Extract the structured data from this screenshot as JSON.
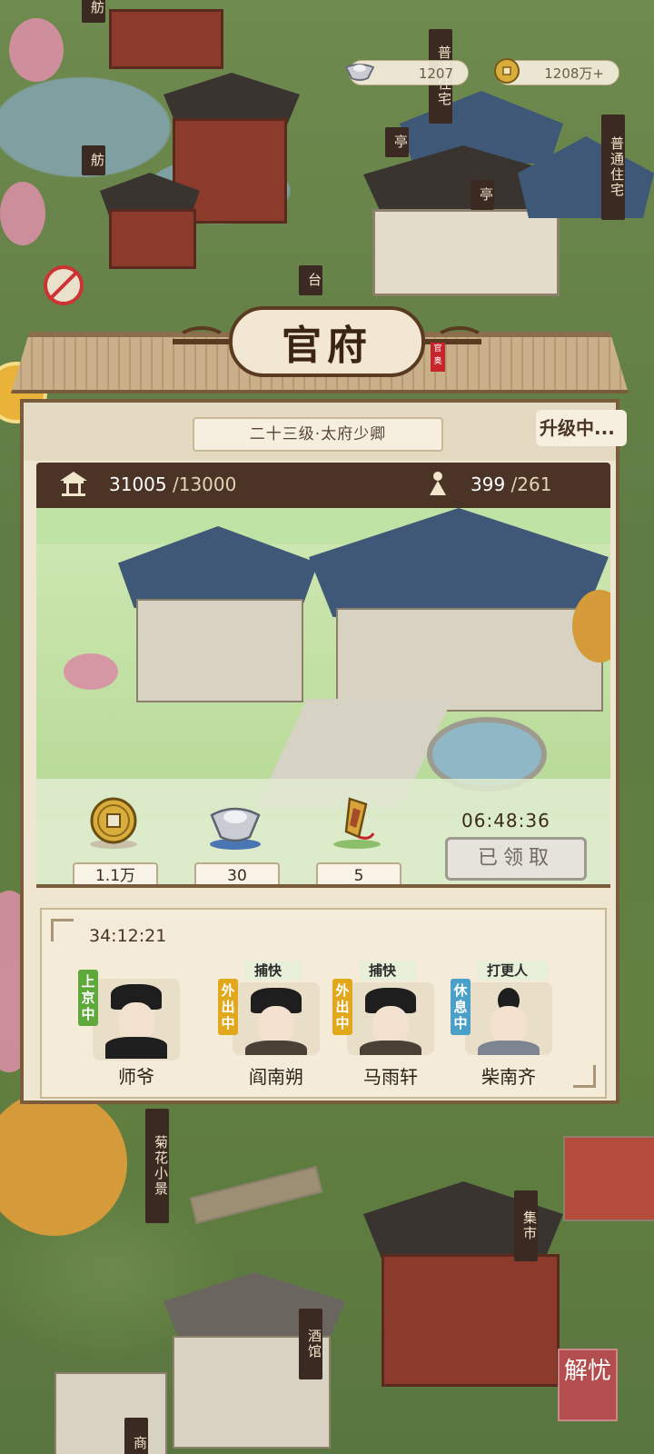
{
  "currencies": {
    "silver": "1207",
    "coin": "1208万+"
  },
  "map_labels": {
    "fang_top": "舫",
    "fang_left": "舫",
    "pu_tong_top": "普通住宅",
    "pu_tong_right": "普通住宅",
    "ting_left": "亭",
    "ting_right": "亭",
    "tai": "台",
    "juhua": "菊花小景",
    "jishi": "集市",
    "jiuguan": "酒馆",
    "shang": "商"
  },
  "panel": {
    "title": "官府",
    "seal": "官奥",
    "rank": "二十三级·太府少卿",
    "status": "升级中...",
    "prosperity": {
      "current": "31005",
      "max": "/13000"
    },
    "population": {
      "current": "399",
      "max": "/261"
    },
    "rewards": [
      {
        "icon": "copper-coin-icon",
        "value": "1.1万"
      },
      {
        "icon": "silver-ingot-icon",
        "value": "30"
      },
      {
        "icon": "token-icon",
        "value": "5"
      }
    ],
    "reward_timer": "06:48:36",
    "claim_label": "已领取"
  },
  "staff": {
    "timer": "34:12:21",
    "members": [
      {
        "name": "师爷",
        "role": "",
        "status": "上京中",
        "status_color": "#5ea83c"
      },
      {
        "name": "阎南朔",
        "role": "捕快",
        "status": "外出中",
        "status_color": "#e0a81a"
      },
      {
        "name": "马雨轩",
        "role": "捕快",
        "status": "外出中",
        "status_color": "#e0a81a"
      },
      {
        "name": "柴南齐",
        "role": "打更人",
        "status": "休息中",
        "status_color": "#4aa0c8"
      }
    ]
  },
  "corner_button": "解忧"
}
